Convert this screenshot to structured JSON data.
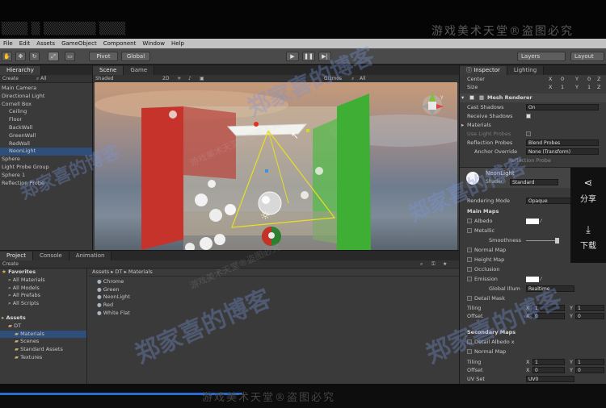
{
  "watermark": {
    "top_text": "游戏美术天堂®盗图必究",
    "bottom_text": "游戏美术天堂®盗图必究",
    "blog_text": "郑家喜的博客",
    "mid_text": "游戏美术天堂®盗图必究"
  },
  "menu": [
    "File",
    "Edit",
    "Assets",
    "GameObject",
    "Component",
    "Window",
    "Help"
  ],
  "toolbar": {
    "pivot": "Pivot",
    "global": "Global",
    "layers": "Layers",
    "layout": "Layout"
  },
  "hierarchy": {
    "tab": "Hierarchy",
    "create": "Create",
    "search": "All",
    "items": [
      {
        "label": "Main Camera",
        "indent": 0,
        "selected": false
      },
      {
        "label": "Directional Light",
        "indent": 0,
        "selected": false
      },
      {
        "label": "Cornell Box",
        "indent": 0,
        "selected": false
      },
      {
        "label": "Ceiling",
        "indent": 1,
        "selected": false
      },
      {
        "label": "Floor",
        "indent": 1,
        "selected": false
      },
      {
        "label": "BackWall",
        "indent": 1,
        "selected": false
      },
      {
        "label": "GreenWall",
        "indent": 1,
        "selected": false
      },
      {
        "label": "RedWall",
        "indent": 1,
        "selected": false
      },
      {
        "label": "NeonLight",
        "indent": 1,
        "selected": true
      },
      {
        "label": "Sphere",
        "indent": 0,
        "selected": false
      },
      {
        "label": "Light Probe Group",
        "indent": 0,
        "selected": false
      },
      {
        "label": "Sphere 1",
        "indent": 0,
        "selected": false
      },
      {
        "label": "Reflection Probe",
        "indent": 0,
        "selected": false
      }
    ]
  },
  "scene": {
    "tab_scene": "Scene",
    "tab_game": "Game",
    "shading": "Shaded",
    "mode2d": "2D",
    "gizmos": "Gizmos",
    "search": "All"
  },
  "project": {
    "tab_project": "Project",
    "tab_console": "Console",
    "tab_animation": "Animation",
    "create": "Create",
    "favorites_label": "Favorites",
    "favorites": [
      "All Materials",
      "All Models",
      "All Prefabs",
      "All Scripts"
    ],
    "assets_label": "Assets",
    "tree": [
      {
        "label": "DT",
        "indent": 1,
        "selected": false
      },
      {
        "label": "Materials",
        "indent": 2,
        "selected": true
      },
      {
        "label": "Scenes",
        "indent": 2,
        "selected": false
      },
      {
        "label": "Standard Assets",
        "indent": 2,
        "selected": false
      },
      {
        "label": "Textures",
        "indent": 2,
        "selected": false
      }
    ],
    "breadcrumb": "Assets ▸ DT ▸ Materials",
    "files": [
      "Chrome",
      "Green",
      "NeonLight",
      "Red",
      "White Flat"
    ]
  },
  "inspector": {
    "tab_inspector": "Inspector",
    "tab_lighting": "Lighting",
    "center_label": "Center",
    "center_x": "X",
    "center_x_val": "0",
    "center_y": "Y",
    "center_y_val": "0",
    "center_z": "Z",
    "center_z_val": "0",
    "size_label": "Size",
    "size_x": "X",
    "size_x_val": "1",
    "size_y": "Y",
    "size_y_val": "1",
    "size_z": "Z",
    "size_z_val": "1",
    "mesh_renderer": "Mesh Renderer",
    "cast_shadows": "Cast Shadows",
    "cast_shadows_val": "On",
    "receive_shadows": "Receive Shadows",
    "materials": "Materials",
    "use_light_probes": "Use Light Probes",
    "reflection_probes": "Reflection Probes",
    "reflection_probes_val": "Blend Probes",
    "anchor_override": "Anchor Override",
    "anchor_override_val": "None (Transform)",
    "reflection_probe_entry": "Reflection Probe",
    "material_name": "NeonLight",
    "shader_label": "Shader",
    "shader_val": "Standard",
    "rendering_mode": "Rendering Mode",
    "rendering_mode_val": "Opaque",
    "main_maps": "Main Maps",
    "albedo": "Albedo",
    "metallic": "Metallic",
    "smoothness": "Smoothness",
    "normal_map": "Normal Map",
    "height_map": "Height Map",
    "occlusion": "Occlusion",
    "emission": "Emission",
    "global_illum": "Global Illum",
    "global_illum_val": "Realtime",
    "detail_mask": "Detail Mask",
    "tiling": "Tiling",
    "tiling_x": "X",
    "tiling_x_val": "1",
    "tiling_y": "Y",
    "tiling_y_val": "1",
    "offset": "Offset",
    "offset_x": "X",
    "offset_x_val": "0",
    "offset_y": "Y",
    "offset_y_val": "0",
    "secondary_maps": "Secondary Maps",
    "detail_albedo": "Detail Albedo x",
    "normal_map2": "Normal Map",
    "tiling2": "Tiling",
    "tiling2_x": "X",
    "tiling2_x_val": "1",
    "tiling2_y": "Y",
    "tiling2_y_val": "1",
    "offset2": "Offset",
    "offset2_x": "X",
    "offset2_x_val": "0",
    "offset2_y": "Y",
    "offset2_y_val": "0",
    "uv_set": "UV Set",
    "uv_set_val": "UV0"
  },
  "share": {
    "share_label": "分享",
    "download_label": "下载"
  },
  "colors": {
    "red_wall": "#c5332b",
    "green_wall": "#3fae35",
    "selection": "#2f4f7a",
    "accent_yellow": "#e8e020"
  }
}
